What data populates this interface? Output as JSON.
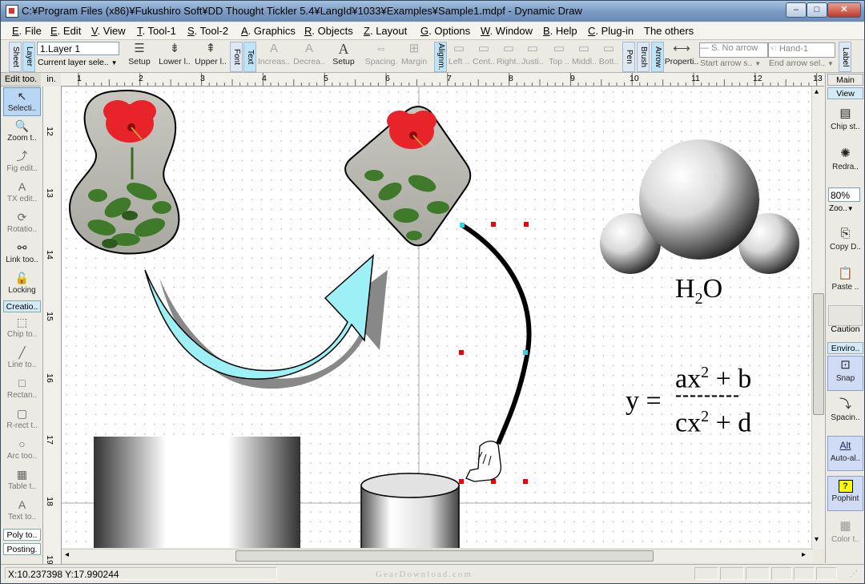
{
  "window": {
    "title": "C:¥Program Files (x86)¥Fukushiro Soft¥DD Thought Tickler 5.4¥LangId¥1033¥Examples¥Sample1.mdpf - Dynamic Draw",
    "minimize": "–",
    "maximize": "□",
    "close": "✕"
  },
  "menu": [
    {
      "key": "E",
      "label": "File"
    },
    {
      "key": "E",
      "label": "Edit"
    },
    {
      "key": "V",
      "label": "View"
    },
    {
      "key": "T",
      "label": "Tool-1"
    },
    {
      "key": "S",
      "label": "Tool-2"
    },
    {
      "key": "A",
      "label": "Graphics"
    },
    {
      "key": "R",
      "label": "Objects"
    },
    {
      "key": "Z",
      "label": "Layout"
    },
    {
      "key": "G",
      "label": "Options"
    },
    {
      "key": "W",
      "label": "Window"
    },
    {
      "key": "B",
      "label": "Help"
    },
    {
      "key": "C",
      "label": "Plug-in"
    },
    {
      "key": "",
      "label": "The others"
    }
  ],
  "toolbar": {
    "sheet": "Sheet",
    "layer": "Layer",
    "layer_value": "1.Layer 1",
    "current_layer": "Current layer sele..",
    "setup": "Setup",
    "lower": "Lower l..",
    "upper": "Upper l..",
    "font": "Font",
    "text": "Text",
    "increase": "Increas..",
    "decrease": "Decrea..",
    "setup2": "Setup",
    "spacing": "Spacing.",
    "margin": "Margin ..",
    "alignment": "Alignm.",
    "left": "Left ..",
    "center": "Cent..",
    "right": "Right..",
    "justify": "Justi..",
    "top": "Top ..",
    "middle": "Middl..",
    "bottom": "Bott..",
    "pen": "Pen",
    "brush": "Brush",
    "arrow": "Arrow",
    "properties": "Properti..",
    "start_arrow_value": "No arrow",
    "start_arrow_key": "S.",
    "start_arrow": "Start arrow s..",
    "end_arrow_value": "Hand-1",
    "end_arrow": "End arrow sel..",
    "label": "Label"
  },
  "left_panel": {
    "header": "Edit too.",
    "unit": "in.",
    "tools": [
      {
        "label": "Selecti..",
        "icon": "↖"
      },
      {
        "label": "Zoom t..",
        "icon": "🔍"
      },
      {
        "label": "Fig edit..",
        "icon": "⤴"
      },
      {
        "label": "TX edit..",
        "icon": "A"
      },
      {
        "label": "Rotatio..",
        "icon": "⟳"
      },
      {
        "label": "Link too..",
        "icon": "⚯"
      },
      {
        "label": "Locking",
        "icon": "🔓"
      }
    ],
    "creation": "Creatio..",
    "creation_tools": [
      {
        "label": "Chip to..",
        "icon": "⬚"
      },
      {
        "label": "Line to..",
        "icon": "╱"
      },
      {
        "label": "Rectan..",
        "icon": "□"
      },
      {
        "label": "R-rect t..",
        "icon": "▢"
      },
      {
        "label": "Arc too..",
        "icon": "○"
      },
      {
        "label": "Table t..",
        "icon": "▦"
      },
      {
        "label": "Text to..",
        "icon": "A"
      }
    ],
    "poly": "Poly to..",
    "posting": "Posting."
  },
  "ruler": {
    "h": [
      "1",
      "2",
      "3",
      "4",
      "5",
      "6",
      "7",
      "8",
      "9",
      "10",
      "11",
      "12",
      "13"
    ],
    "v": [
      "12",
      "13",
      "14",
      "15",
      "16",
      "17",
      "18",
      "19"
    ]
  },
  "canvas": {
    "h2o_h": "H",
    "h2o_sub": "2",
    "h2o_o": "O",
    "y_eq": "y =",
    "numer": "ax",
    "numer_sup": "2",
    "numer_rest": " + b",
    "dashes": "---------",
    "denom": "cx",
    "denom_sup": "2",
    "denom_rest": " + d"
  },
  "right_panel": {
    "main": "Main",
    "view": "View",
    "chip": "Chip st..",
    "redraw": "Redra..",
    "zoom_value": "80%",
    "zoom": "Zoo..",
    "copy": "Copy D..",
    "paste": "Paste ..",
    "caution": "Caution",
    "environment": "Enviro..",
    "snap": "Snap",
    "spacing": "Spacin..",
    "autoalign": "Auto-al..",
    "autoalign_icon": "Alt",
    "pophint": "Pophint",
    "pophint_icon": "?",
    "color": "Color t.."
  },
  "status": {
    "coords": "X:10.237398 Y:17.990244"
  },
  "watermark": "GearDownload.com"
}
